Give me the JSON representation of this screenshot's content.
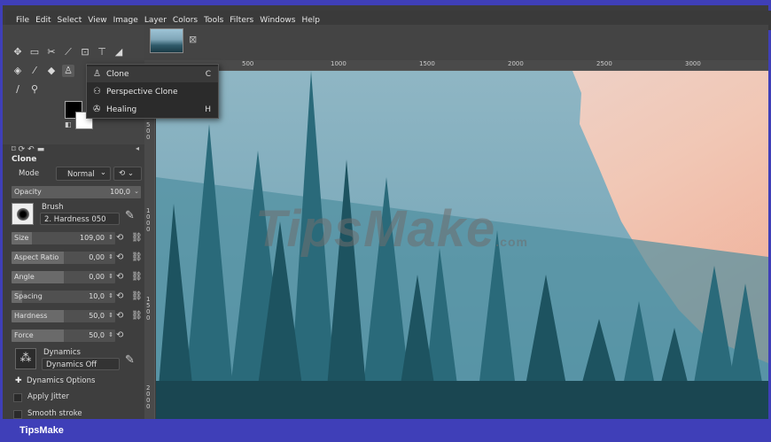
{
  "menu": [
    "File",
    "Edit",
    "Select",
    "View",
    "Image",
    "Layer",
    "Colors",
    "Tools",
    "Filters",
    "Windows",
    "Help"
  ],
  "ruler_h": [
    "500",
    "1000",
    "1500",
    "2000",
    "2500",
    "3000"
  ],
  "ruler_v": [
    "500",
    "1000",
    "1500",
    "2000"
  ],
  "dropdown": [
    {
      "icon": "clone-icon",
      "label": "Clone",
      "shortcut": "C"
    },
    {
      "icon": "perspective-clone-icon",
      "label": "Perspective Clone",
      "shortcut": ""
    },
    {
      "icon": "healing-icon",
      "label": "Healing",
      "shortcut": "H"
    }
  ],
  "tool_options": {
    "title": "Clone",
    "mode_label": "Mode",
    "mode_value": "Normal",
    "opacity_label": "Opacity",
    "opacity_value": "100,0",
    "brush_label": "Brush",
    "brush_value": "2. Hardness 050",
    "dynamics_label": "Dynamics",
    "dynamics_value": "Dynamics Off",
    "dynamics_options": "Dynamics Options",
    "apply_jitter": "Apply Jitter",
    "smooth_stroke": "Smooth stroke"
  },
  "sliders": [
    {
      "label": "Size",
      "value": "109,00",
      "fill": 0.2
    },
    {
      "label": "Aspect Ratio",
      "value": "0,00",
      "fill": 0.5
    },
    {
      "label": "Angle",
      "value": "0,00",
      "fill": 0.5
    },
    {
      "label": "Spacing",
      "value": "10,0",
      "fill": 0.1
    },
    {
      "label": "Hardness",
      "value": "50,0",
      "fill": 0.5
    },
    {
      "label": "Force",
      "value": "50,0",
      "fill": 0.5
    }
  ],
  "watermark": {
    "text": "TipsMake",
    "suffix": ".com"
  },
  "footer": "TipsMake"
}
